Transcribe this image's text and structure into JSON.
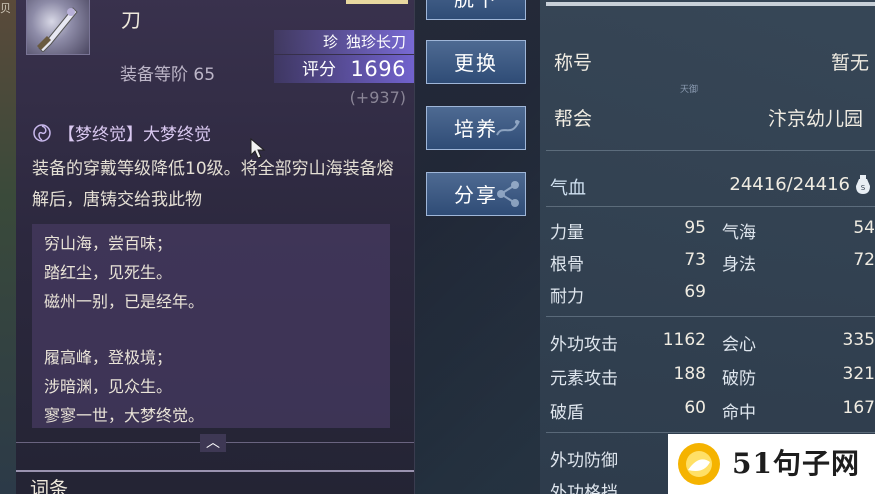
{
  "edge": {
    "glyph": "贝"
  },
  "item": {
    "name": "刀",
    "quality_tag": "珍",
    "quality_name": "独珍长刀",
    "tier_label": "装备等阶",
    "tier_value": "65",
    "score_label": "评分",
    "score_value": "1696",
    "score_delta": "(+937)",
    "set_title": "【梦终觉】大梦终觉",
    "description": "装备的穿戴等级降低10级。将全部穷山海装备熔解后，唐铸交给我此物",
    "poem": [
      "穷山海，尝百味；",
      "踏红尘，见死生。",
      "磁州一别，已是经年。",
      "履高峰，登极境；",
      "涉暗渊，见众生。",
      "寥寥一世，大梦终觉。"
    ],
    "expand_glyph": "︿",
    "section_heading": "词条"
  },
  "buttons": {
    "remove": "脱下",
    "change": "更换",
    "cultivate": "培养",
    "share": "分享"
  },
  "stats": {
    "title_label": "称号",
    "title_value": "暂无",
    "tiny_mark": "天御",
    "guild_label": "帮会",
    "guild_value": "汴京幼儿园",
    "hp_label": "气血",
    "hp_value": "24416/24416",
    "attrs_left": [
      {
        "label": "力量",
        "value": "95"
      },
      {
        "label": "根骨",
        "value": "73"
      },
      {
        "label": "耐力",
        "value": "69"
      }
    ],
    "attrs_right": [
      {
        "label": "气海",
        "value": "54"
      },
      {
        "label": "身法",
        "value": "72"
      }
    ],
    "combat_left": [
      {
        "label": "外功攻击",
        "value": "1162"
      },
      {
        "label": "元素攻击",
        "value": "188"
      },
      {
        "label": "破盾",
        "value": "60"
      }
    ],
    "combat_right": [
      {
        "label": "会心",
        "value": "335"
      },
      {
        "label": "破防",
        "value": "321"
      },
      {
        "label": "命中",
        "value": "167"
      }
    ],
    "defense": [
      {
        "label": "外功防御"
      },
      {
        "label": "外功格挡"
      }
    ]
  },
  "watermark": {
    "text": "51句子网"
  },
  "colors": {
    "quality_purple": "#8474ec",
    "button_blue": "#2f4c76",
    "panel_bg": "#2c283e",
    "stats_bg": "#2e3c4c"
  }
}
